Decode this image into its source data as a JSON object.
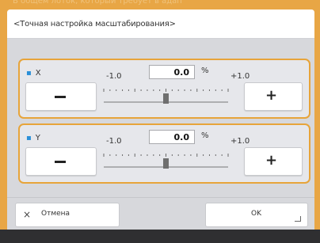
{
  "background": {
    "caption": "В общем лоток, который требует в адап"
  },
  "dialog": {
    "title": "<Точная настройка масштабирования>",
    "accent_color": "#e7a43a",
    "panels": [
      {
        "axis": "X",
        "min_label": "-1.0",
        "max_label": "+1.0",
        "value": "0.0",
        "unit": "%",
        "minus": "−",
        "plus": "+",
        "slider_value": 0.0
      },
      {
        "axis": "Y",
        "min_label": "-1.0",
        "max_label": "+1.0",
        "value": "0.0",
        "unit": "%",
        "minus": "−",
        "plus": "+",
        "slider_value": 0.0
      }
    ],
    "footer": {
      "cancel_icon": "×",
      "cancel_label": "Отмена",
      "ok_label": "OK"
    }
  }
}
